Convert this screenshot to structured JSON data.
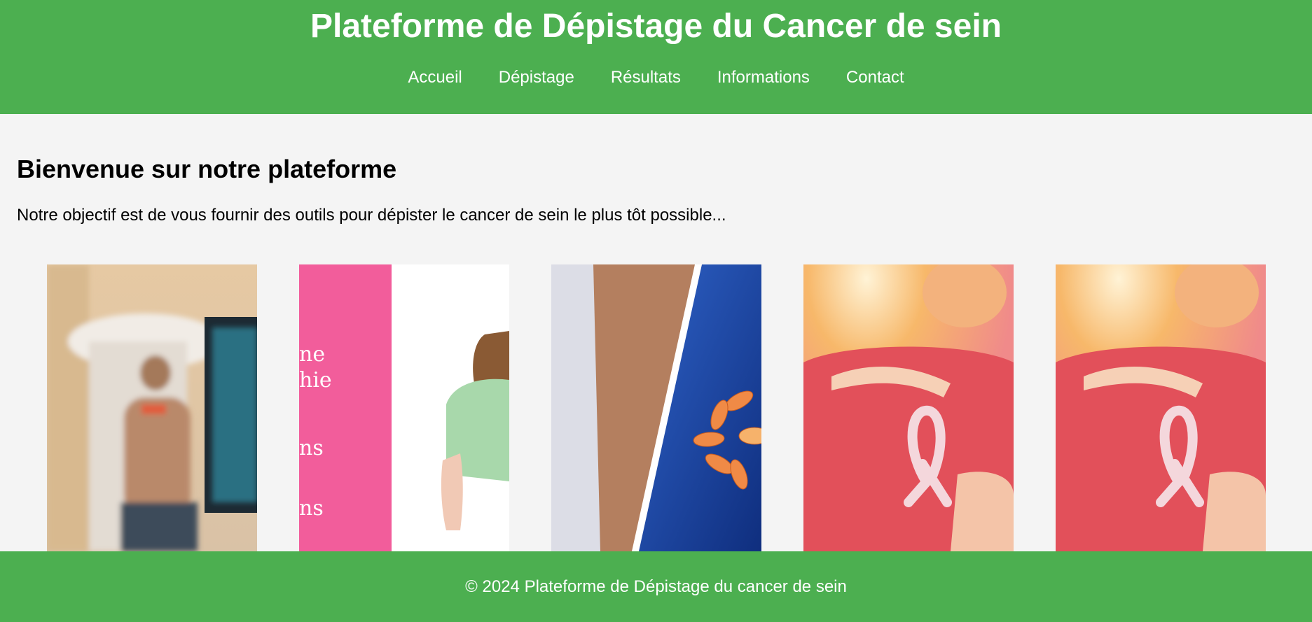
{
  "header": {
    "title": "Plateforme de Dépistage du Cancer de sein",
    "nav": [
      {
        "label": "Accueil"
      },
      {
        "label": "Dépistage"
      },
      {
        "label": "Résultats"
      },
      {
        "label": "Informations"
      },
      {
        "label": "Contact"
      }
    ]
  },
  "main": {
    "heading": "Bienvenue sur notre plateforme",
    "intro": "Notre objectif est de vous fournir des outils pour dépister le cancer de sein le plus tôt possible...",
    "gallery": [
      {
        "subject": "mammography-exam"
      },
      {
        "subject": "pink-panel-illustration",
        "visible_text_fragments": [
          "ne",
          "hie",
          "ns",
          "ns"
        ]
      },
      {
        "subject": "breast-xray-illustration"
      },
      {
        "subject": "pink-ribbon-woman"
      },
      {
        "subject": "pink-ribbon-woman"
      }
    ]
  },
  "footer": {
    "text": "© 2024 Plateforme de Dépistage du cancer de sein"
  },
  "colors": {
    "primary": "#4caf50",
    "background": "#f4f4f4",
    "header_text": "#ffffff",
    "body_text": "#000000",
    "ribbon_pink": "#f25d9b"
  }
}
